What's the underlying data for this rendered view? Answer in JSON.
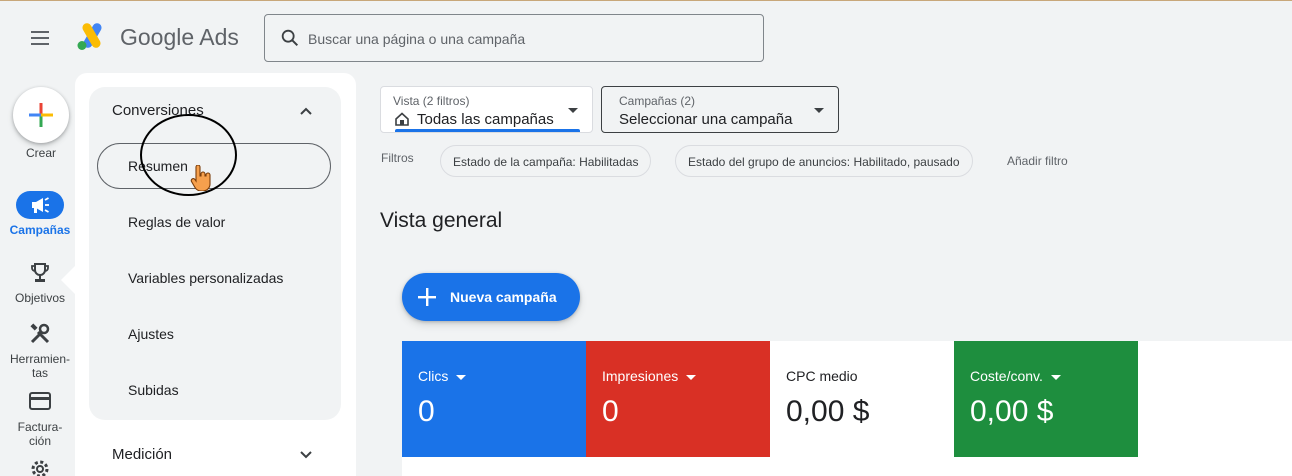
{
  "header": {
    "app_name": "Google Ads",
    "search_placeholder": "Buscar una página o una campaña"
  },
  "rail": {
    "create_label": "Crear",
    "items": [
      {
        "label": "Campañas",
        "icon": "megaphone-icon",
        "active": true
      },
      {
        "label": "Objetivos",
        "icon": "trophy-icon"
      },
      {
        "label": "Herramien-\ntas",
        "line1": "Herramien-",
        "line2": "tas",
        "icon": "tools-icon"
      },
      {
        "label": "Factura-\nción",
        "line1": "Factura-",
        "line2": "ción",
        "icon": "credit-card-icon"
      },
      {
        "label": "",
        "icon": "gear-icon"
      }
    ]
  },
  "flyout": {
    "group_title": "Conversiones",
    "items": [
      "Resumen",
      "Reglas de valor",
      "Variables personalizadas",
      "Ajustes",
      "Subidas"
    ],
    "next_group": "Medición"
  },
  "controls": {
    "view_small": "Vista (2 filtros)",
    "view_value": "Todas las campañas",
    "campaigns_small": "Campañas (2)",
    "campaigns_value": "Seleccionar una campaña",
    "filters_label": "Filtros",
    "filter_chips": [
      "Estado de la campaña: Habilitadas",
      "Estado del grupo de anuncios: Habilitado, pausado"
    ],
    "add_filter": "Añadir filtro"
  },
  "main": {
    "title": "Vista general",
    "new_campaign": "Nueva campaña"
  },
  "metrics": [
    {
      "label": "Clics",
      "value": "0",
      "color": "#1a73e8",
      "has_dropdown": true
    },
    {
      "label": "Impresiones",
      "value": "0",
      "color": "#d93025",
      "has_dropdown": true
    },
    {
      "label": "CPC medio",
      "value": "0,00 $",
      "color": "#ffffff",
      "has_dropdown": false
    },
    {
      "label": "Coste/conv.",
      "value": "0,00 $",
      "color": "#1e8e3e",
      "has_dropdown": true
    }
  ],
  "colors": {
    "accent": "#1a73e8",
    "red": "#d93025",
    "green": "#1e8e3e"
  }
}
